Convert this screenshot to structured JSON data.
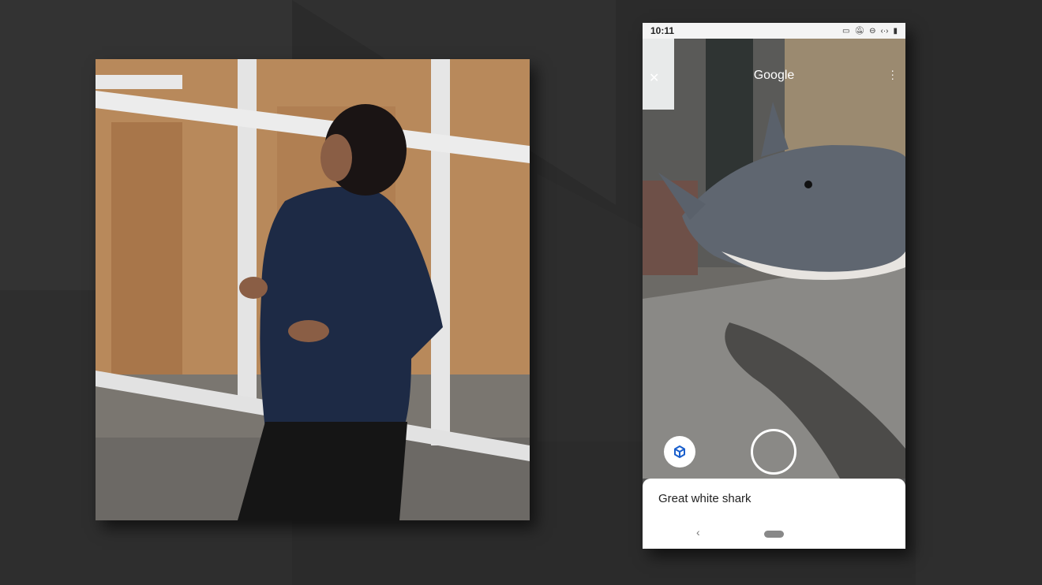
{
  "phone": {
    "status_time": "10:11",
    "status_icons": [
      "cast-icon",
      "notifications-off-icon",
      "do-not-disturb-icon",
      "data-saver-icon",
      "battery-icon"
    ],
    "app_logo": "Google",
    "result_title": "Great white shark",
    "colors": {
      "accent": "#1a5fcc",
      "sheet": "#ffffff"
    }
  }
}
